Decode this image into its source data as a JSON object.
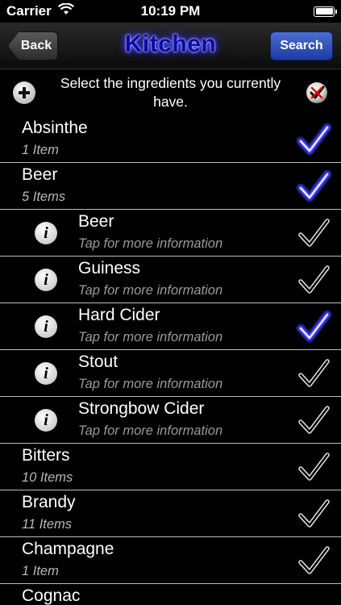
{
  "status_bar": {
    "carrier": "Carrier",
    "time": "10:19 PM",
    "icons": [
      "wifi-icon",
      "battery-icon"
    ]
  },
  "nav": {
    "back_label": "Back",
    "title": "Kitchen",
    "search_label": "Search"
  },
  "header": {
    "text": "Select the ingredients you currently have.",
    "icons": [
      "add-icon",
      "clear-all-icon"
    ]
  },
  "colors": {
    "accent_glow": "#3c3cff",
    "search_button": "#2d4fb8",
    "subtitle_gray": "#b8b8b8"
  },
  "rows": [
    {
      "kind": "category",
      "title": "Absinthe",
      "subtitle": "1 Item",
      "checked": true
    },
    {
      "kind": "category",
      "title": "Beer",
      "subtitle": "5 Items",
      "checked": true
    },
    {
      "kind": "item",
      "title": "Beer",
      "subtitle": "Tap for more information",
      "checked": false
    },
    {
      "kind": "item",
      "title": "Guiness",
      "subtitle": "Tap for more information",
      "checked": false
    },
    {
      "kind": "item",
      "title": "Hard Cider",
      "subtitle": "Tap for more information",
      "checked": true
    },
    {
      "kind": "item",
      "title": "Stout",
      "subtitle": "Tap for more information",
      "checked": false
    },
    {
      "kind": "item",
      "title": "Strongbow Cider",
      "subtitle": "Tap for more information",
      "checked": false
    },
    {
      "kind": "category",
      "title": "Bitters",
      "subtitle": "10 Items",
      "checked": false
    },
    {
      "kind": "category",
      "title": "Brandy",
      "subtitle": "11 Items",
      "checked": false
    },
    {
      "kind": "category",
      "title": "Champagne",
      "subtitle": "1 Item",
      "checked": false
    },
    {
      "kind": "category",
      "title": "Cognac",
      "subtitle": "",
      "checked": false
    }
  ]
}
